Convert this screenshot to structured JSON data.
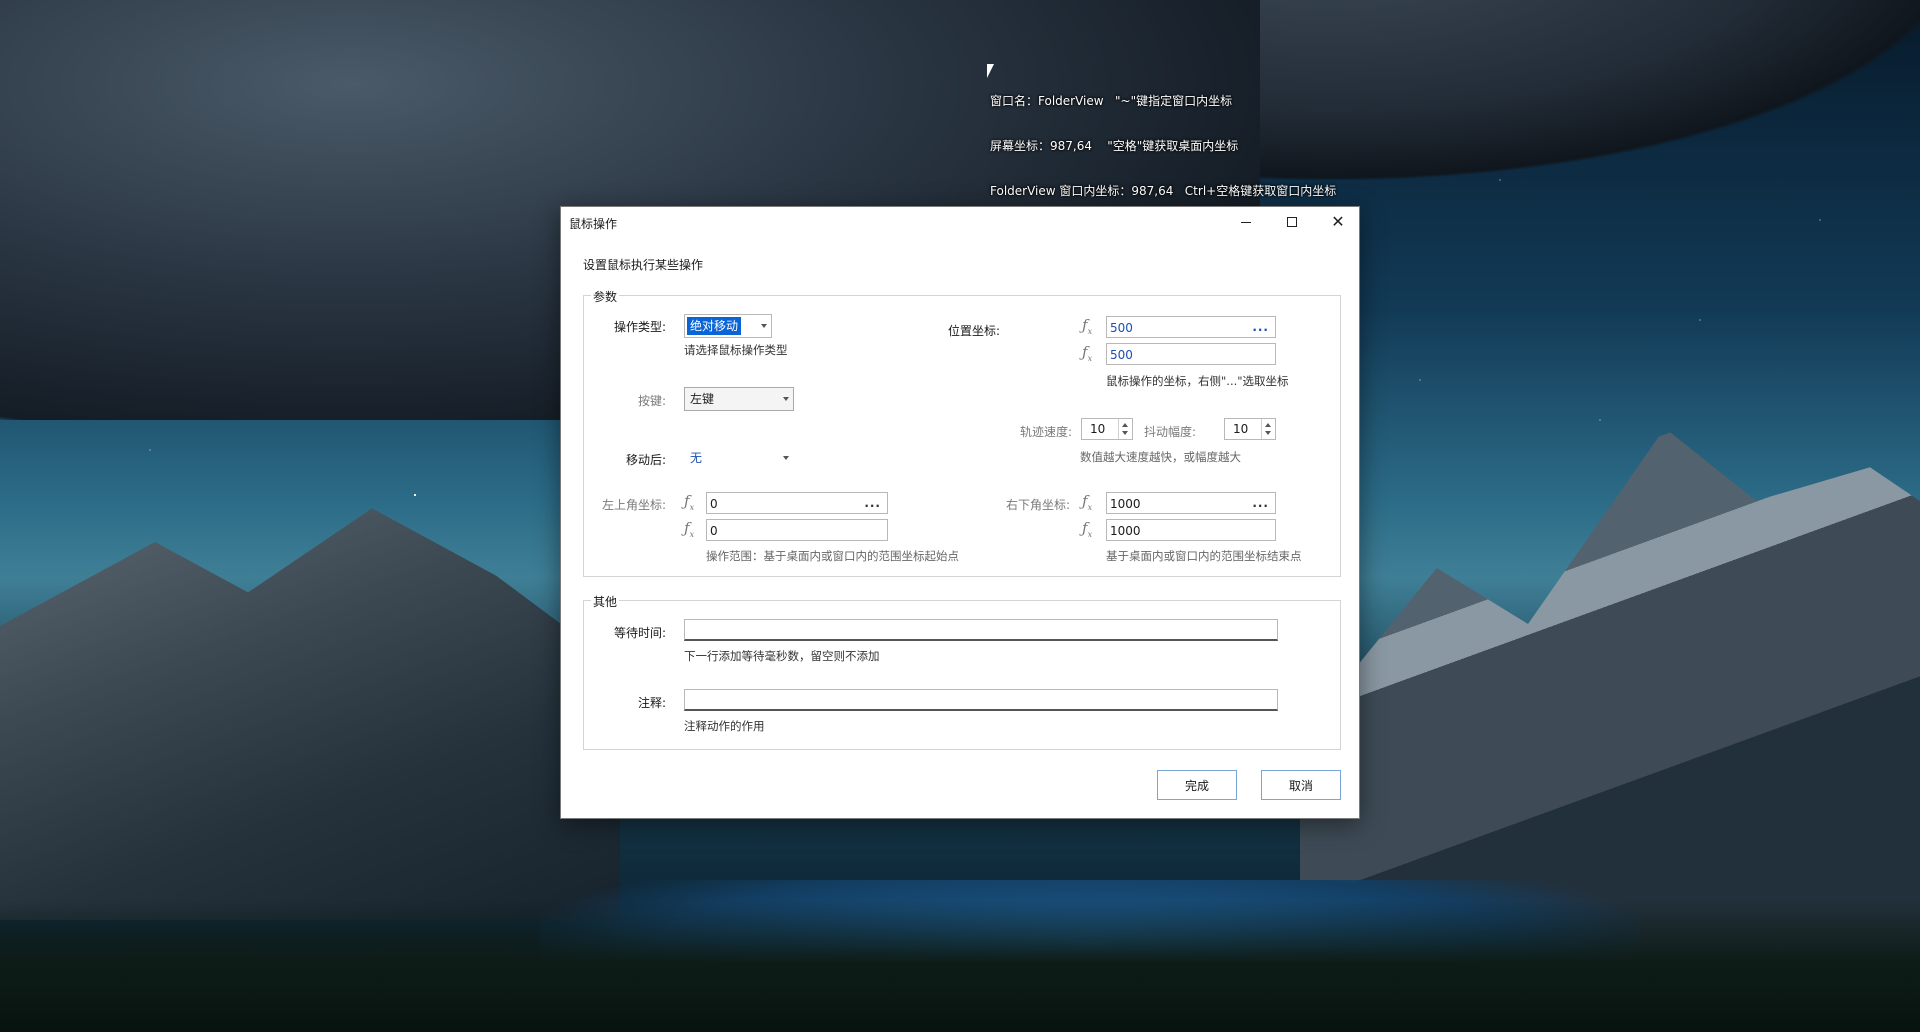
{
  "overlay": {
    "line1": "窗口名：FolderView   \"~\"键指定窗口内坐标",
    "line2": "屏幕坐标：987,64    \"空格\"键获取桌面内坐标",
    "line3": "FolderView 窗口内坐标：987,64   Ctrl+空格键获取窗口内坐标"
  },
  "dialog": {
    "title": "鼠标操作",
    "subtitle": "设置鼠标执行某些操作",
    "params": {
      "legend": "参数",
      "op_type_label": "操作类型:",
      "op_type_value": "绝对移动",
      "op_type_hint": "请选择鼠标操作类型",
      "key_label": "按键:",
      "key_value": "左键",
      "after_move_label": "移动后:",
      "after_move_value": "无",
      "position_label": "位置坐标:",
      "position_x": "500",
      "position_y": "500",
      "position_hint": "鼠标操作的坐标，右侧\"...\"选取坐标",
      "track_speed_label": "轨迹速度:",
      "track_speed_value": "10",
      "shake_label": "抖动幅度:",
      "shake_value": "10",
      "speed_hint": "数值越大速度越快，或幅度越大",
      "top_left_label": "左上角坐标:",
      "top_left_x": "0",
      "top_left_y": "0",
      "top_left_hint": "操作范围：基于桌面内或窗口内的范围坐标起始点",
      "bottom_right_label": "右下角坐标:",
      "bottom_right_x": "1000",
      "bottom_right_y": "1000",
      "bottom_right_hint": "基于桌面内或窗口内的范围坐标结束点",
      "ellipsis": "..."
    },
    "other": {
      "legend": "其他",
      "wait_label": "等待时间:",
      "wait_value": "",
      "wait_hint": "下一行添加等待毫秒数，留空则不添加",
      "note_label": "注释:",
      "note_value": "",
      "note_hint": "注释动作的作用"
    },
    "buttons": {
      "done": "完成",
      "cancel": "取消"
    },
    "fx_symbol": "ƒ",
    "fx_sub": "x"
  },
  "colors": {
    "accent": "#0a64d6",
    "link_blue": "#1a4fb4",
    "button_border": "#7aa5d6"
  }
}
